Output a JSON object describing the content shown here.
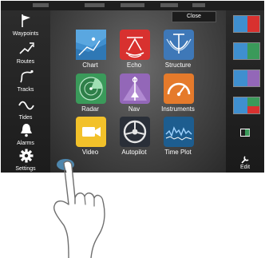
{
  "sidebar": {
    "items": [
      {
        "label": "Waypoints",
        "icon": "flag-icon"
      },
      {
        "label": "Routes",
        "icon": "route-icon"
      },
      {
        "label": "Tracks",
        "icon": "track-icon"
      },
      {
        "label": "Tides",
        "icon": "tide-wave-icon"
      },
      {
        "label": "Alarms",
        "icon": "bell-icon"
      },
      {
        "label": "Settings",
        "icon": "gear-icon"
      }
    ]
  },
  "main": {
    "close_label": "Close",
    "apps": [
      {
        "label": "Chart",
        "icon": "chart-icon",
        "color": "#3f8fcf"
      },
      {
        "label": "Echo",
        "icon": "echo-icon",
        "color": "#d8312f"
      },
      {
        "label": "Structure",
        "icon": "structure-icon",
        "color": "#3e78b8"
      },
      {
        "label": "Radar",
        "icon": "radar-icon",
        "color": "#3a9a5a"
      },
      {
        "label": "Nav",
        "icon": "nav-icon",
        "color": "#9367b8"
      },
      {
        "label": "Instruments",
        "icon": "instruments-icon",
        "color": "#e57a2b"
      },
      {
        "label": "Video",
        "icon": "video-icon",
        "color": "#f2c12a"
      },
      {
        "label": "Autopilot",
        "icon": "autopilot-icon",
        "color": "#2a2f38"
      },
      {
        "label": "Time Plot",
        "icon": "time-plot-icon",
        "color": "#1d5d8f"
      }
    ]
  },
  "rightcol": {
    "edit_label": "Edit"
  },
  "colors": {
    "accent": "#3f8fcf",
    "tap_marker": "#4d86ad"
  }
}
